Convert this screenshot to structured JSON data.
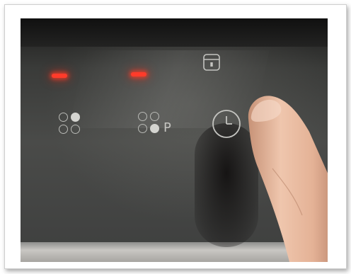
{
  "scene": {
    "description_kind": "photo-of-induction-hob-touch-controls",
    "colors": {
      "glass": "#3a3b39",
      "led_active": "#ff3b2a",
      "symbol": "#c4c4c0",
      "frame": "#ffffff",
      "skin": "#e2b59b"
    }
  },
  "controls": {
    "zone_left": {
      "icon": "cooking-zone-selector-icon",
      "led_on": true
    },
    "zone_right": {
      "icon": "cooking-zone-selector-icon",
      "label": "P",
      "led_on": true
    },
    "lock": {
      "icon": "child-lock-icon"
    },
    "timer": {
      "icon": "timer-clock-icon"
    }
  }
}
